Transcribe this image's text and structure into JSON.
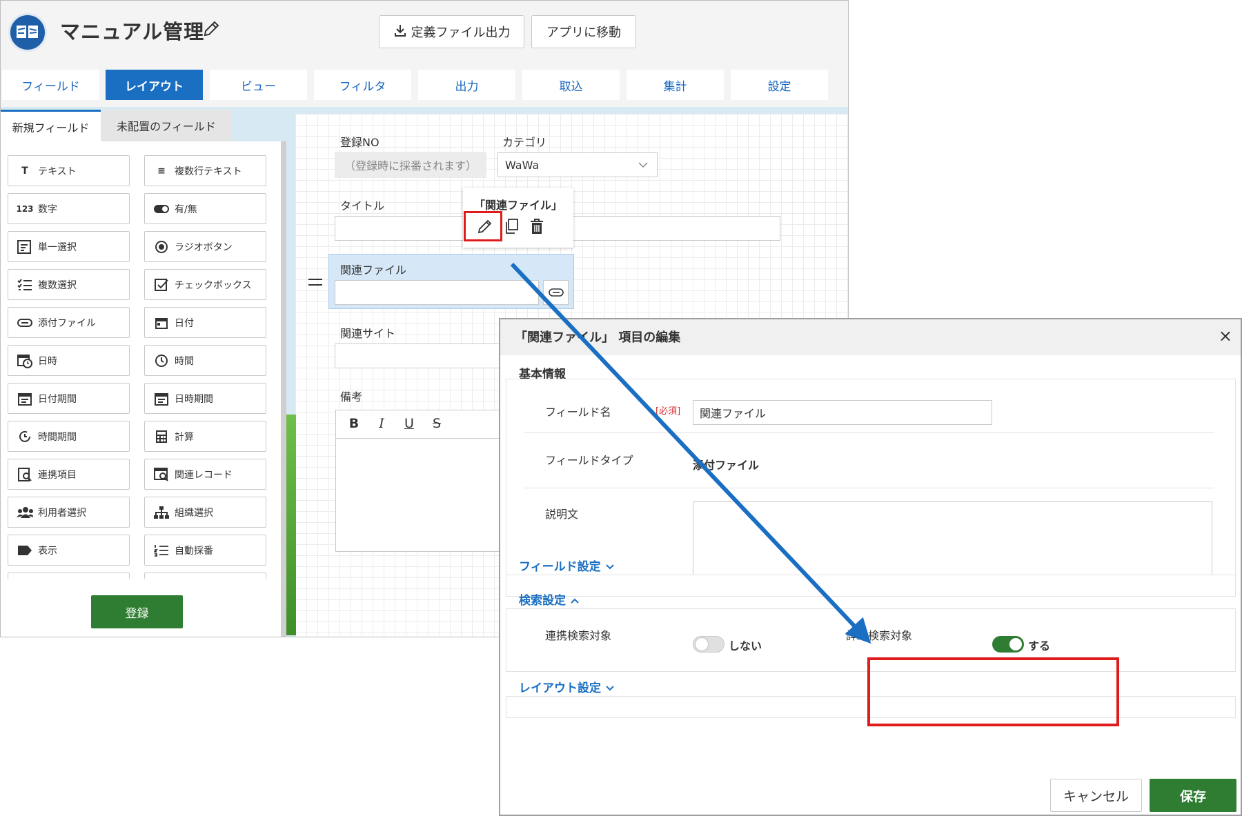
{
  "app": {
    "title": "マニュアル管理",
    "export_label": "定義ファイル出力",
    "goto_label": "アプリに移動"
  },
  "tabs": [
    "フィールド",
    "レイアウト",
    "ビュー",
    "フィルタ",
    "出力",
    "取込",
    "集計",
    "設定"
  ],
  "active_tab": "レイアウト",
  "left_panel": {
    "tab_new": "新規フィールド",
    "tab_unplaced": "未配置のフィールド",
    "fields": [
      {
        "label": "テキスト",
        "icon": "text-icon"
      },
      {
        "label": "複数行テキスト",
        "icon": "multiline-text-icon"
      },
      {
        "label": "数字",
        "icon": "number-icon"
      },
      {
        "label": "有/無",
        "icon": "toggle-icon"
      },
      {
        "label": "単一選択",
        "icon": "single-select-icon"
      },
      {
        "label": "ラジオボタン",
        "icon": "radio-icon"
      },
      {
        "label": "複数選択",
        "icon": "multi-select-icon"
      },
      {
        "label": "チェックボックス",
        "icon": "checkbox-icon"
      },
      {
        "label": "添付ファイル",
        "icon": "paperclip-icon"
      },
      {
        "label": "日付",
        "icon": "calendar-icon"
      },
      {
        "label": "日時",
        "icon": "calendar-clock-icon"
      },
      {
        "label": "時間",
        "icon": "clock-icon"
      },
      {
        "label": "日付期間",
        "icon": "date-range-icon"
      },
      {
        "label": "日時期間",
        "icon": "datetime-range-icon"
      },
      {
        "label": "時間期間",
        "icon": "time-range-icon"
      },
      {
        "label": "計算",
        "icon": "calculator-icon"
      },
      {
        "label": "連携項目",
        "icon": "linked-item-icon"
      },
      {
        "label": "関連レコード",
        "icon": "related-record-icon"
      },
      {
        "label": "利用者選択",
        "icon": "users-icon"
      },
      {
        "label": "組織選択",
        "icon": "org-chart-icon"
      },
      {
        "label": "表示",
        "icon": "label-tag-icon"
      },
      {
        "label": "自動採番",
        "icon": "numbered-list-icon"
      }
    ],
    "register_label": "登録"
  },
  "form": {
    "reg_no_label": "登録NO",
    "reg_no_value": "（登録時に採番されます）",
    "category_label": "カテゴリ",
    "category_value": "WaWa",
    "title_label": "タイトル",
    "related_file_label": "関連ファイル",
    "related_site_label": "関連サイト",
    "remarks_label": "備考",
    "rte_buttons": [
      "B",
      "I",
      "U",
      "S"
    ]
  },
  "popup": {
    "title": "「関連ファイル」"
  },
  "dialog": {
    "title": "「関連ファイル」 項目の編集",
    "close": "×",
    "basic_info": "基本情報",
    "field_name_label": "フィールド名",
    "required": "[必須]",
    "field_name_value": "関連ファイル",
    "field_type_label": "フィールドタイプ",
    "field_type_value": "添付ファイル",
    "description_label": "説明文",
    "field_settings": "フィールド設定",
    "search_settings": "検索設定",
    "linked_search_label": "連携検索対象",
    "linked_search_value": "しない",
    "linked_search_on": false,
    "detail_search_label": "詳細検索対象",
    "detail_search_value": "する",
    "detail_search_on": true,
    "layout_settings": "レイアウト設定",
    "cancel_label": "キャンセル",
    "save_label": "保存"
  },
  "colors": {
    "accent_blue": "#1a6fc2",
    "green": "#2e7d32",
    "highlight_red": "#e01b1b"
  }
}
